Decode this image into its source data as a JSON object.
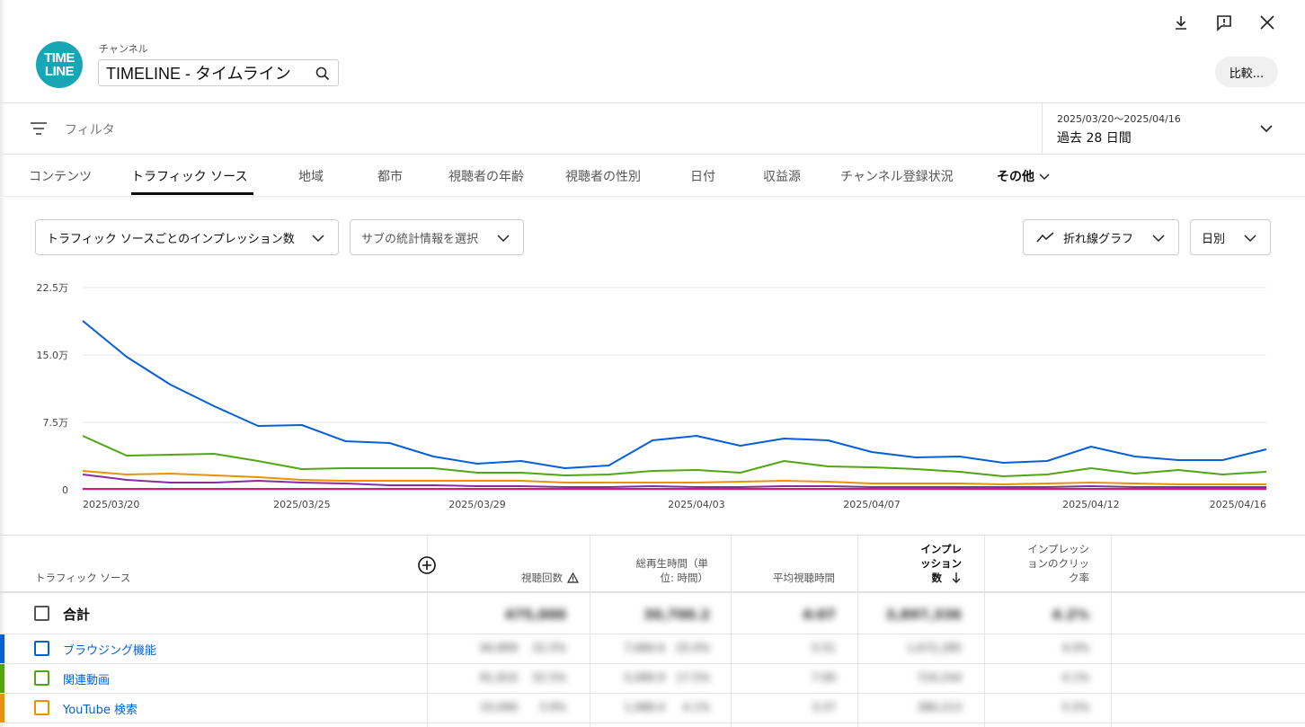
{
  "channel": {
    "label": "チャンネル",
    "name": "TIMELINE - タイムライン",
    "logo_top": "TIME",
    "logo_bottom": "LINE"
  },
  "header_actions": {
    "compare_label": "比較..."
  },
  "filter": {
    "placeholder": "フィルタ"
  },
  "date": {
    "range": "2025/03/20〜2025/04/16",
    "period": "過去 28 日間"
  },
  "tabs": [
    "コンテンツ",
    "トラフィック ソース",
    "地域",
    "都市",
    "視聴者の年齢",
    "視聴者の性別",
    "日付",
    "収益源",
    "チャンネル登録状況",
    "その他"
  ],
  "controls": {
    "metric": "トラフィック ソースごとのインプレッション数",
    "sub_metric": "サブの統計情報を選択",
    "chart_type": "折れ線グラフ",
    "granularity": "日別"
  },
  "chart_data": {
    "type": "line",
    "ylim": [
      0,
      225000
    ],
    "yticks": [
      0,
      75000,
      150000,
      225000
    ],
    "ytick_labels": [
      "0",
      "7.5万",
      "15.0万",
      "22.5万"
    ],
    "xtick_labels": [
      "2025/03/20",
      "2025/03/25",
      "2025/03/29",
      "2025/04/03",
      "2025/04/07",
      "2025/04/12",
      "2025/04/16"
    ],
    "xtick_index": [
      0,
      5,
      9,
      14,
      18,
      23,
      27
    ],
    "x": [
      "2025/03/20",
      "2025/03/21",
      "2025/03/22",
      "2025/03/23",
      "2025/03/24",
      "2025/03/25",
      "2025/03/26",
      "2025/03/27",
      "2025/03/28",
      "2025/03/29",
      "2025/03/30",
      "2025/03/31",
      "2025/04/01",
      "2025/04/02",
      "2025/04/03",
      "2025/04/04",
      "2025/04/05",
      "2025/04/06",
      "2025/04/07",
      "2025/04/08",
      "2025/04/09",
      "2025/04/10",
      "2025/04/11",
      "2025/04/12",
      "2025/04/13",
      "2025/04/14",
      "2025/04/15",
      "2025/04/16"
    ],
    "grid": true,
    "series": [
      {
        "color": "#065fd4",
        "values": [
          188000,
          148000,
          117000,
          93000,
          71000,
          72000,
          54000,
          52000,
          37000,
          29000,
          32000,
          24000,
          27000,
          55000,
          60000,
          49000,
          57000,
          55000,
          42000,
          36000,
          37000,
          30000,
          32000,
          48000,
          37000,
          33000,
          33000,
          45000
        ]
      },
      {
        "color": "#52a614",
        "values": [
          60000,
          38000,
          39000,
          40000,
          32000,
          23000,
          24000,
          24000,
          24000,
          19000,
          19000,
          16000,
          17000,
          21000,
          22000,
          19000,
          32000,
          26000,
          25000,
          23000,
          20000,
          15000,
          17000,
          24000,
          18000,
          22000,
          17000,
          20000
        ]
      },
      {
        "color": "#e8910c",
        "values": [
          21000,
          17000,
          18000,
          16000,
          14000,
          11000,
          10000,
          10000,
          10000,
          10000,
          10000,
          8000,
          8000,
          8000,
          8000,
          9000,
          10000,
          9000,
          7000,
          7000,
          7000,
          6000,
          7000,
          8000,
          7000,
          6000,
          6000,
          6000
        ]
      },
      {
        "color": "#8b2a9c",
        "values": [
          17000,
          11000,
          8000,
          8000,
          10000,
          8000,
          7000,
          5000,
          5000,
          4000,
          4000,
          3000,
          3000,
          4000,
          3000,
          3000,
          4000,
          4000,
          3000,
          3000,
          3000,
          3000,
          3000,
          4000,
          3000,
          3000,
          3000,
          3000
        ]
      },
      {
        "color": "#d6197e",
        "values": [
          1000,
          1000,
          1000,
          1000,
          1000,
          1000,
          1000,
          1000,
          1000,
          1000,
          1000,
          1000,
          1000,
          1000,
          1000,
          1000,
          1000,
          1000,
          1000,
          1000,
          1000,
          1000,
          1000,
          1000,
          1000,
          1000,
          1000,
          1000
        ]
      }
    ]
  },
  "table": {
    "headers": {
      "source": "トラフィック ソース",
      "views": "視聴回数",
      "watch_time_1": "総再生時間（単",
      "watch_time_2": "位: 時間）",
      "avg": "平均視聴時間",
      "impr_1": "インプレ",
      "impr_2": "ッション",
      "impr_3": "数",
      "ctr_1": "インプレッシ",
      "ctr_2": "ョンのクリッ",
      "ctr_3": "ク率"
    },
    "total": {
      "label": "合計",
      "views": "475,000",
      "watch": "30,700.2",
      "avg": "4:07",
      "impr": "3,897,336",
      "ctr": "4.2%"
    },
    "rows": [
      {
        "label": "ブラウジング機能",
        "color": "#065fd4",
        "views": "94,899",
        "views_pct": "32.5%",
        "watch": "7,684.6",
        "watch_pct": "25.0%",
        "avg": "5:51",
        "impr": "1,672,285",
        "ctr": "4.0%"
      },
      {
        "label": "関連動画",
        "color": "#52a614",
        "views": "81,810",
        "views_pct": "32.5%",
        "watch": "5,089.9",
        "watch_pct": "17.5%",
        "avg": "7:00",
        "impr": "724,244",
        "ctr": "4.1%"
      },
      {
        "label": "YouTube 検索",
        "color": "#e8910c",
        "views": "33,090",
        "views_pct": "3.9%",
        "watch": "1,088.4",
        "watch_pct": "4.1%",
        "avg": "3:37",
        "impr": "380,213",
        "ctr": "5.5%"
      }
    ]
  }
}
